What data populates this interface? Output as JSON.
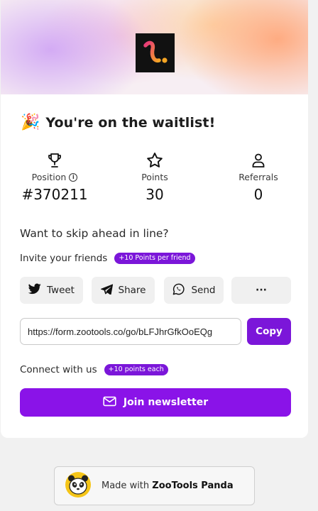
{
  "header": {
    "title": "You're on the waitlist!"
  },
  "stats": [
    {
      "label": "Position",
      "value": "#370211",
      "icon": "trophy-icon"
    },
    {
      "label": "Points",
      "value": "30",
      "icon": "star-icon"
    },
    {
      "label": "Referrals",
      "value": "0",
      "icon": "user-icon"
    }
  ],
  "skip_heading": "Want to skip ahead in line?",
  "invite": {
    "label": "Invite your friends",
    "badge": "+10 Points per friend"
  },
  "share_buttons": [
    {
      "label": "Tweet",
      "icon": "twitter-icon"
    },
    {
      "label": "Share",
      "icon": "telegram-icon"
    },
    {
      "label": "Send",
      "icon": "whatsapp-icon"
    },
    {
      "label": "···",
      "icon": "more-icon"
    }
  ],
  "referral": {
    "link": "https://form.zootools.co/go/bLFJhrGfkOoEQg",
    "copy_label": "Copy"
  },
  "connect": {
    "label": "Connect with us",
    "badge": "+10 points each",
    "newsletter_label": "Join newsletter"
  },
  "footer": {
    "prefix": "Made with",
    "brand": "ZooTools Panda"
  },
  "colors": {
    "accent": "#7b16d9",
    "background": "#f1f1f1",
    "logo_gradient_start": "#e8387a",
    "logo_gradient_end": "#f5a524"
  }
}
